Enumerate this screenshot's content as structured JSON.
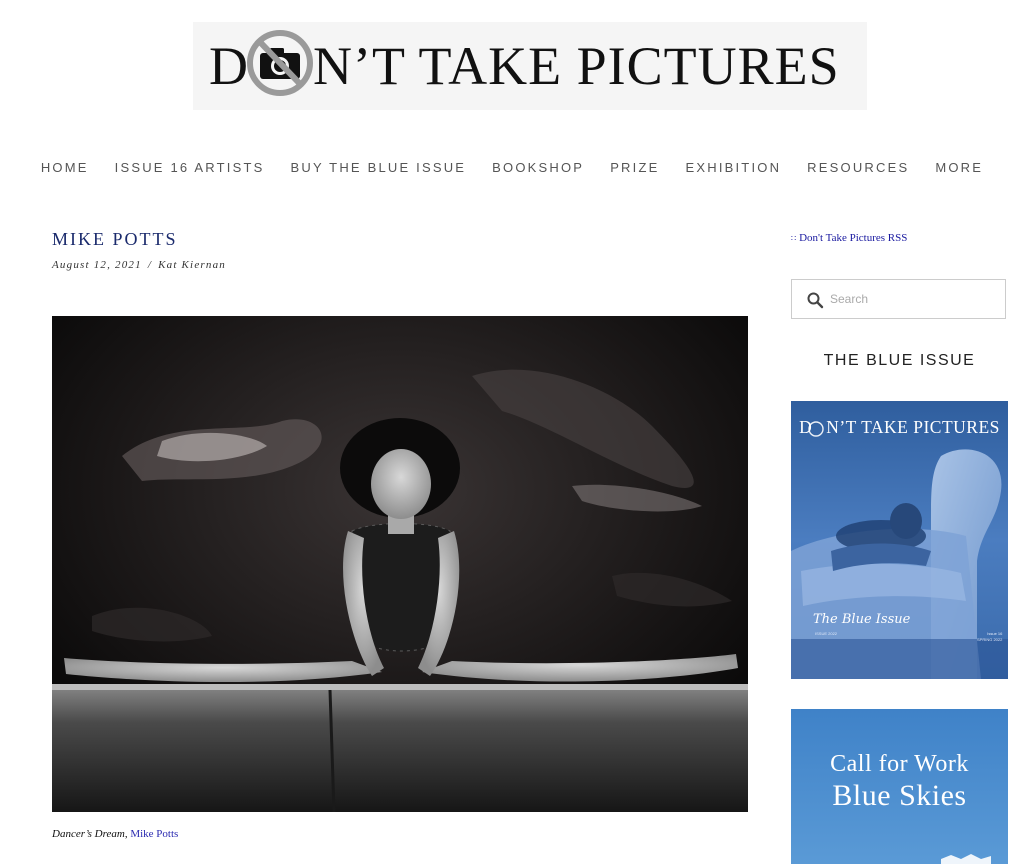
{
  "site": {
    "logo_text_start": "D",
    "logo_text_end": "N’T TAKE PICTURES"
  },
  "nav": {
    "items": [
      {
        "label": "HOME"
      },
      {
        "label": "ISSUE 16 ARTISTS"
      },
      {
        "label": "BUY THE BLUE ISSUE"
      },
      {
        "label": "BOOKSHOP"
      },
      {
        "label": "PRIZE"
      },
      {
        "label": "EXHIBITION"
      },
      {
        "label": "RESOURCES"
      },
      {
        "label": "MORE"
      }
    ]
  },
  "post": {
    "title": "MIKE POTTS",
    "date": "August 12, 2021",
    "separator": "/",
    "author": "Kat Kiernan",
    "caption_title": "Dancer’s Dream",
    "caption_sep": ", ",
    "caption_artist": "Mike Potts"
  },
  "sidebar": {
    "rss_label": "Don't Take Pictures RSS",
    "search_placeholder": "Search",
    "widget_title": "THE BLUE ISSUE",
    "cover": {
      "title": "DON'T TAKE PICTURES",
      "title_start": "D",
      "title_end": "N’T TAKE PICTURES",
      "subtitle": "The Blue Issue",
      "small_left": "ISSUE 2022",
      "small_right_1": "Issue 16",
      "small_right_2": "SPRING 2022"
    },
    "call": {
      "line1": "Call for Work",
      "line2": "Blue Skies"
    }
  },
  "icons": {
    "logo_badge": "no-camera-icon",
    "rss": "rss-icon",
    "search": "search-icon"
  },
  "colors": {
    "title_navy": "#1a2a6c",
    "link_blue": "#1a1aa0",
    "nav_gray": "#555555",
    "cover_blue": "#4a78b8",
    "call_blue": "#3f82c8"
  }
}
